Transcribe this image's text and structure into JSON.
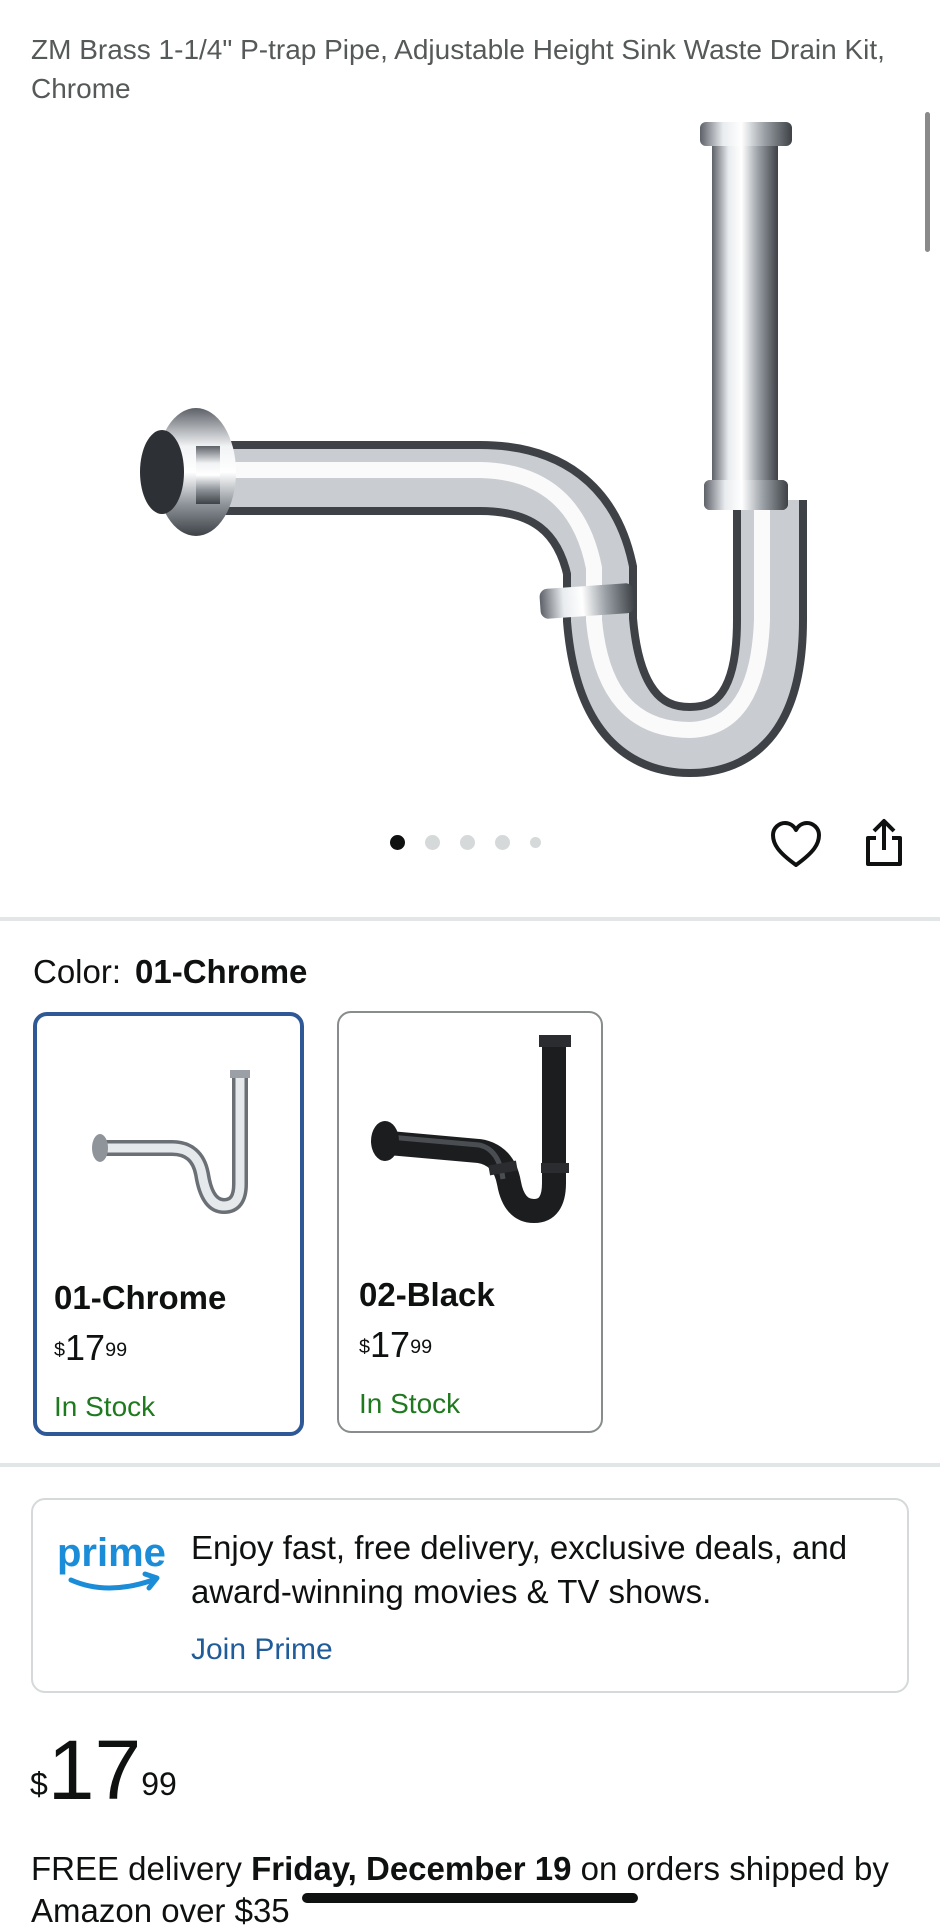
{
  "product": {
    "title": "ZM Brass 1-1/4\" P-trap Pipe, Adjustable Height Sink Waste Drain Kit, Chrome"
  },
  "gallery": {
    "image_count": 5,
    "active_index": 0,
    "favorite_icon": "heart-icon",
    "share_icon": "share-icon"
  },
  "color": {
    "label": "Color:",
    "selected": "01-Chrome",
    "options": [
      {
        "name": "01-Chrome",
        "currency": "$",
        "whole": "17",
        "fraction": "99",
        "stock": "In Stock"
      },
      {
        "name": "02-Black",
        "currency": "$",
        "whole": "17",
        "fraction": "99",
        "stock": "In Stock"
      }
    ]
  },
  "prime": {
    "logo_text": "prime",
    "message": "Enjoy fast, free delivery, exclusive deals, and award-winning movies & TV shows.",
    "link": "Join Prime"
  },
  "price": {
    "currency": "$",
    "whole": "17",
    "fraction": "99"
  },
  "delivery": {
    "prefix": "FREE delivery ",
    "date": "Friday, December 19",
    "suffix": " on orders shipped by Amazon over $35"
  },
  "colors": {
    "selected_border": "#2f5996",
    "in_stock": "#1f7a1f",
    "link": "#1f5c99",
    "prime_blue": "#1a8cd8"
  }
}
